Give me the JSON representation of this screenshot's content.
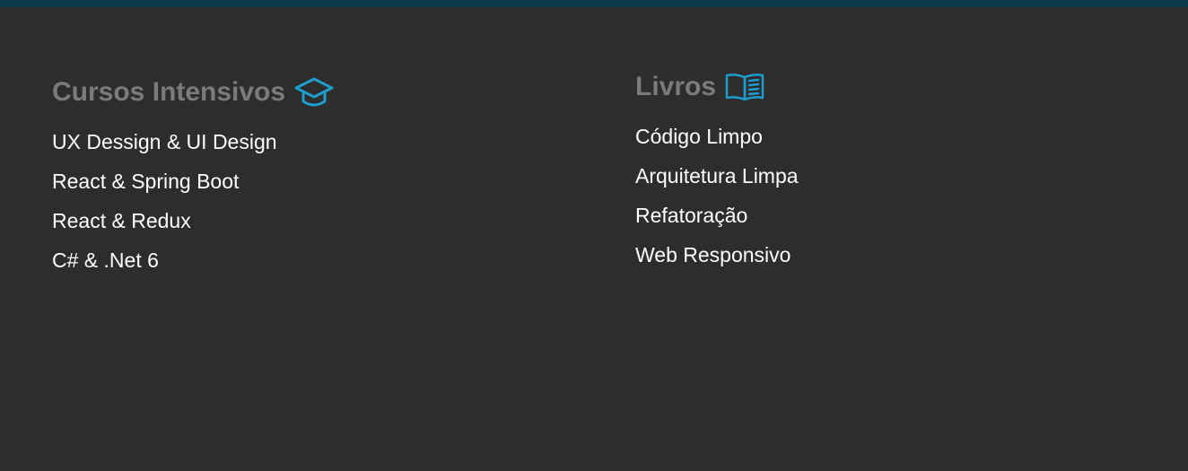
{
  "colors": {
    "accent": "#1e9ccc",
    "heading": "#7b7b7b",
    "background": "#2d2d2d",
    "top_bar": "#0d3a4a",
    "link": "#ffffff"
  },
  "courses": {
    "title": "Cursos Intensivos",
    "icon": "graduation-cap-icon",
    "items": [
      {
        "label": "UX Dessign & UI Design"
      },
      {
        "label": "React & Spring Boot"
      },
      {
        "label": "React & Redux"
      },
      {
        "label": "C# & .Net 6"
      }
    ]
  },
  "books": {
    "title": "Livros",
    "icon": "open-book-icon",
    "items": [
      {
        "label": "Código Limpo"
      },
      {
        "label": "Arquitetura Limpa"
      },
      {
        "label": "Refatoração"
      },
      {
        "label": "Web Responsivo"
      }
    ]
  }
}
